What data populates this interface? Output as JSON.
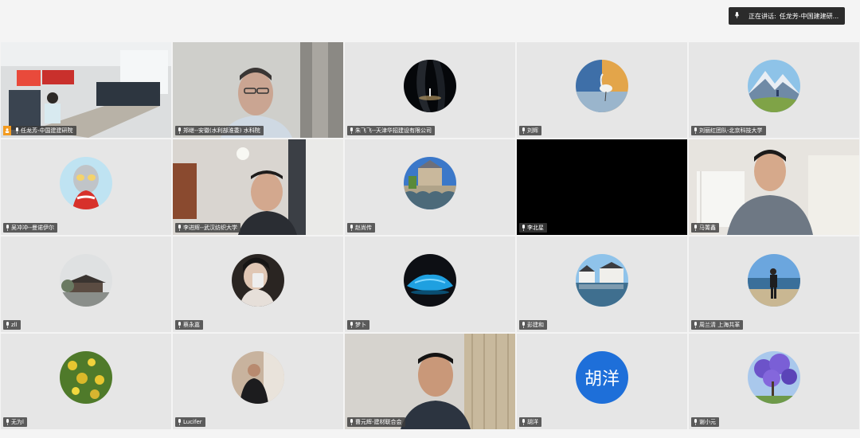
{
  "speaking": {
    "label": "正在讲话:",
    "name": "任龙芳-中国建建研..."
  },
  "tiles": [
    {
      "name": "任龙芳-中国建建研院",
      "host": true,
      "active": true,
      "type": "video-room"
    },
    {
      "name": "郑继--安徽(水利部淮委) 水科院",
      "type": "video-man-glasses"
    },
    {
      "name": "朱飞飞--天津华招建设有限公司",
      "type": "avatar-night"
    },
    {
      "name": "刘辉",
      "type": "avatar-bird"
    },
    {
      "name": "刘丽红团队-北京科技大学",
      "type": "avatar-mountain"
    },
    {
      "name": "吴冲冲--曼诺伊尔",
      "type": "avatar-hero"
    },
    {
      "name": "李进辉--武汉纺织大学",
      "type": "video-man-room"
    },
    {
      "name": "赵尚传",
      "type": "avatar-castle"
    },
    {
      "name": "李北星",
      "type": "black"
    },
    {
      "name": "马箐鑫",
      "type": "video-man-light"
    },
    {
      "name": "zll",
      "type": "avatar-fog"
    },
    {
      "name": "蔡永嘉",
      "type": "avatar-person"
    },
    {
      "name": "梦卜",
      "type": "avatar-car"
    },
    {
      "name": "彭建和",
      "type": "avatar-town"
    },
    {
      "name": "周兰清 上海共革",
      "type": "avatar-beach"
    },
    {
      "name": "无为l",
      "type": "avatar-flower"
    },
    {
      "name": "Lucifer",
      "type": "avatar-man-dark"
    },
    {
      "name": "曹元辉-建材联合会",
      "type": "video-man-curtain"
    },
    {
      "name": "胡洋",
      "type": "avatar-text",
      "text": "胡洋",
      "color": "#1e6fd9"
    },
    {
      "name": "谢小元",
      "type": "avatar-tree"
    }
  ]
}
